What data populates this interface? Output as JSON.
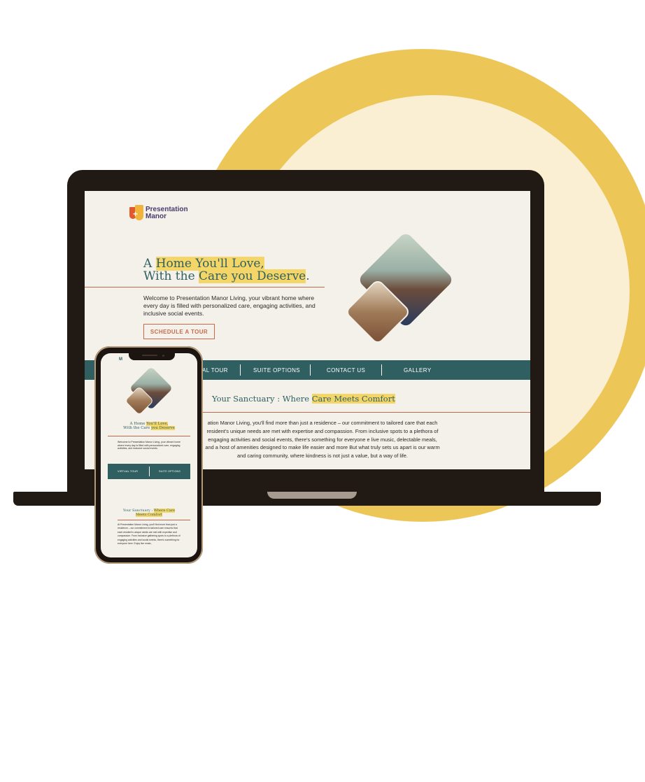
{
  "colors": {
    "circle_outer": "#ecc758",
    "circle_inner": "#fbefd3",
    "brand_teal": "#2f5f60",
    "accent_orange": "#c96b4b",
    "highlight_yellow": "#f4d567",
    "device_frame": "#211a14"
  },
  "laptop": {
    "logo": {
      "line1": "Presentation",
      "line2": "Manor",
      "icon": "presentation-manor-logo"
    },
    "hero": {
      "line1_pre": "A ",
      "line1_hl": "Home You'll Love,",
      "line2_pre": "With the ",
      "line2_hl": "Care you Deserve",
      "line2_post": ".",
      "description": "Welcome to Presentation Manor Living, your vibrant home where every day is filled with personalized care, engaging activities, and inclusive social events.",
      "cta": "SCHEDULE A TOUR"
    },
    "nav": [
      "AL TOUR",
      "SUITE OPTIONS",
      "CONTACT US",
      "GALLERY"
    ],
    "section": {
      "title_pre": "Your Sanctuary : Where ",
      "title_hl": "Care Meets Comfort",
      "body": "ation Manor Living, you'll find more than just a residence – our commitment to tailored care that each resident's unique needs are met with expertise and compassion. From inclusive spots to a plethora of engaging activities and social events, there's something for everyone e live music, delectable meals, and a host of amenities designed to make life easier and more But what truly sets us apart is our warm and caring community, where kindness is not just a value, but a way of life."
    }
  },
  "phone": {
    "top_letter": "M",
    "hero": {
      "line1_pre": "A Home ",
      "line1_hl": "You'll Love,",
      "line2_pre": "With the Care ",
      "line2_hl": "you Deserve",
      "description": "Welcome to Presentation Manor Living, your vibrant home where every day is filled with personalized care, engaging activities, and inclusive social events."
    },
    "nav": [
      "VIRTUAL TOUR",
      "SUITE OPTIONS"
    ],
    "section": {
      "title_pre": "Your Sanctuary : ",
      "title_hl1": "Where Care",
      "title_hl2": "Meets Comfort",
      "body": "At Presentation Manor Living, you'll find more than just a residence – our commitment to tailored care ensures that each resident's unique needs are met with expertise and compassion. From inclusive gathering spots to a plethora of engaging activities and social events, there's something for everyone here. Enjoy live music,"
    }
  }
}
